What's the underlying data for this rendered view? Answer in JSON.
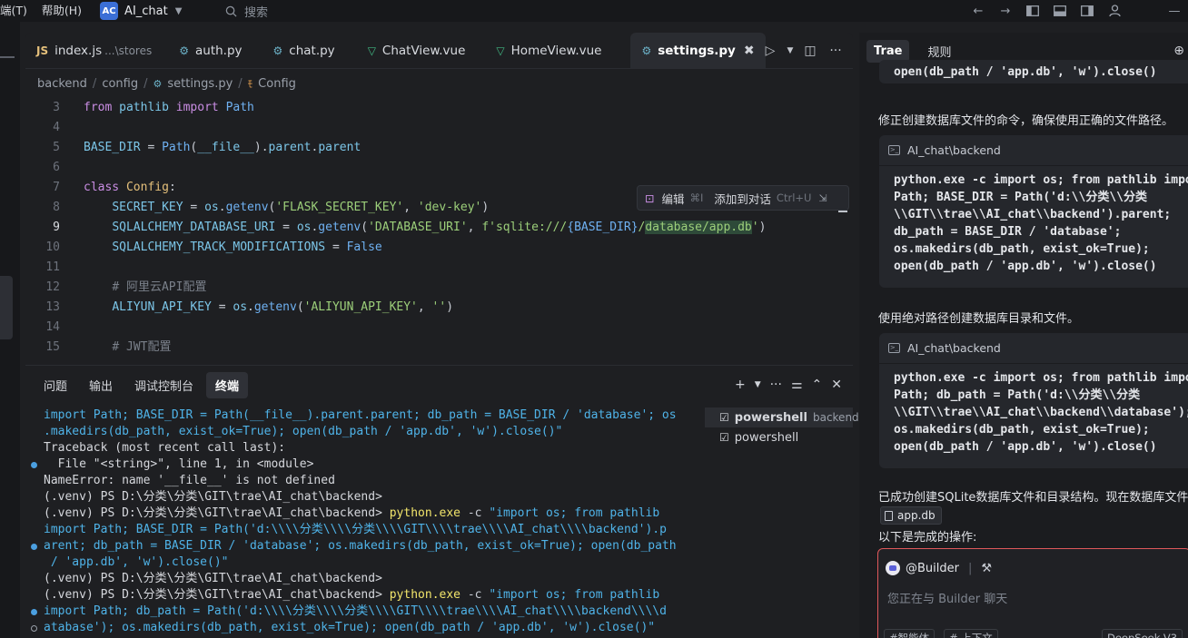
{
  "titlebar": {
    "menus": [
      "端(T)",
      "帮助(H)"
    ],
    "project_badge": "AC",
    "project_name": "AI_chat",
    "search_placeholder": "搜索"
  },
  "editor": {
    "tabs": [
      {
        "icon": "JS",
        "label": "index.js",
        "sub": "...\\stores"
      },
      {
        "icon": "py",
        "label": "auth.py"
      },
      {
        "icon": "py",
        "label": "chat.py"
      },
      {
        "icon": "vue",
        "label": "ChatView.vue"
      },
      {
        "icon": "vue",
        "label": "HomeView.vue"
      },
      {
        "icon": "py",
        "label": "settings.py",
        "active": true
      }
    ],
    "breadcrumb": [
      "backend",
      "config",
      "settings.py",
      "Config"
    ],
    "line_numbers": [
      "3",
      "4",
      "5",
      "6",
      "7",
      "8",
      "9",
      "10",
      "11",
      "12",
      "13",
      "14",
      "15"
    ],
    "current_line": "9",
    "hover_toolbar": {
      "edit": "编辑",
      "edit_hotkey": "⌘I",
      "add": "添加到对话",
      "add_hotkey": "Ctrl+U"
    }
  },
  "panel": {
    "tabs": [
      "问题",
      "输出",
      "调试控制台",
      "终端"
    ],
    "active_tab": "终端",
    "terminals": [
      {
        "name": "powershell",
        "tag": "backend"
      },
      {
        "name": "powershell",
        "tag": ""
      }
    ]
  },
  "chat": {
    "tabs": [
      "Trae",
      "规则"
    ],
    "top_code_tail": "open(db_path / 'app.db', 'w').close()",
    "msg1": "修正创建数据库文件的命令，确保使用正确的文件路径。",
    "block1_title": "AI_chat\\backend",
    "block1_lines": [
      "python.exe -c import os; from pathlib impo",
      "Path; BASE_DIR = Path('d:\\\\分类\\\\分类",
      "\\\\GIT\\\\trae\\\\AI_chat\\\\backend').parent;",
      "db_path = BASE_DIR / 'database';",
      "os.makedirs(db_path, exist_ok=True);",
      "open(db_path / 'app.db', 'w').close()"
    ],
    "msg2": "使用绝对路径创建数据库目录和文件。",
    "block2_title": "AI_chat\\backend",
    "block2_lines": [
      "python.exe -c import os; from pathlib impo",
      "Path; db_path = Path('d:\\\\分类\\\\分类",
      "\\\\GIT\\\\trae\\\\AI_chat\\\\backend\\\\database');",
      "os.makedirs(db_path, exist_ok=True);",
      "open(db_path / 'app.db', 'w').close()"
    ],
    "msg3": "已成功创建SQLite数据库文件和目录结构。现在数据库文件",
    "file_chip": "app.db",
    "msg4": "以下是完成的操作:",
    "composer": {
      "mention": "@Builder",
      "placeholder": "您正在与 Builder 聊天",
      "chip1": "#智能体",
      "chip2": "# 上下文",
      "model": "DeepSeek-V3"
    }
  },
  "colors": {
    "accent": "#3b6fd6",
    "composer_border": "#e0585b",
    "string": "#9ccf7a",
    "keyword": "#c98de3"
  }
}
